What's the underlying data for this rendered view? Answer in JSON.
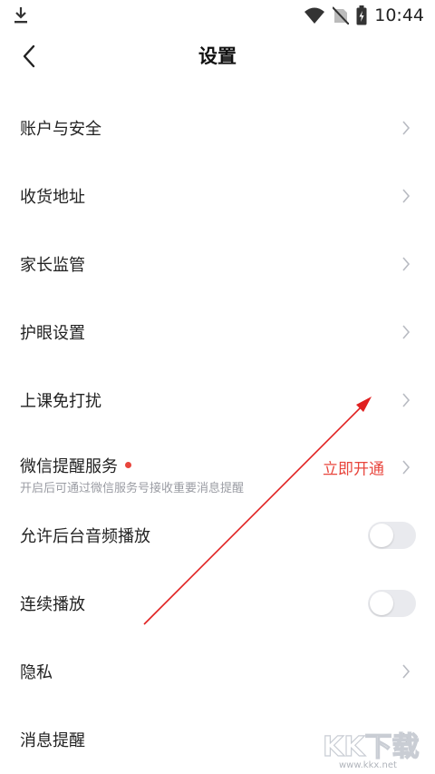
{
  "status_bar": {
    "time": "10:44",
    "icons": [
      "download-icon",
      "wifi-icon",
      "no-sim-icon",
      "battery-icon"
    ]
  },
  "header": {
    "title": "设置",
    "back_icon": "back-chevron-icon"
  },
  "settings": {
    "items": [
      {
        "label": "账户与安全",
        "type": "link"
      },
      {
        "label": "收货地址",
        "type": "link"
      },
      {
        "label": "家长监管",
        "type": "link"
      },
      {
        "label": "护眼设置",
        "type": "link"
      },
      {
        "label": "上课免打扰",
        "type": "link"
      },
      {
        "label": "微信提醒服务",
        "type": "link-action",
        "subtitle": "开启后可通过微信服务号接收重要消息提醒",
        "action": "立即开通",
        "badge": "red-dot"
      },
      {
        "label": "允许后台音频播放",
        "type": "toggle",
        "on": false
      },
      {
        "label": "连续播放",
        "type": "toggle",
        "on": false
      },
      {
        "label": "隐私",
        "type": "link"
      },
      {
        "label": "消息提醒",
        "type": "link"
      }
    ]
  },
  "watermark": {
    "logo_text": "KK下载",
    "url": "www.kkx.net"
  },
  "colors": {
    "accent_red": "#e8453c",
    "chevron": "#b8bbc2",
    "toggle_off": "#e9eaee",
    "subtitle": "#9a9ca3"
  }
}
